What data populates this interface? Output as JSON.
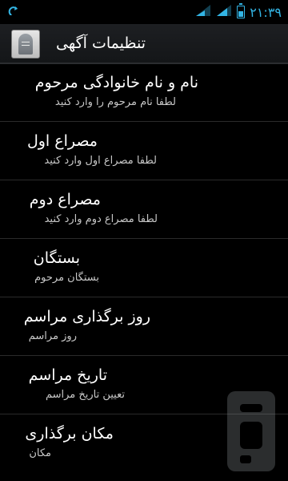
{
  "status_bar": {
    "time": "۲۱:۳۹",
    "icons": [
      "sync-icon",
      "signal-icon",
      "wifi-icon",
      "battery-icon"
    ],
    "accent_color": "#33b5e5"
  },
  "action_bar": {
    "title": "تنظیمات آگهی",
    "icon": "gravestone-app-icon"
  },
  "settings": [
    {
      "title": "نام و نام خانوادگی مرحوم",
      "summary": "لطفا نام مرحوم را وارد کنید"
    },
    {
      "title": "مصراع اول",
      "summary": "لطفا مصراع اول وارد کنید"
    },
    {
      "title": "مصراع دوم",
      "summary": "لطفا مصراع دوم وارد کنید"
    },
    {
      "title": "بستگان",
      "summary": "بستگان مرحوم"
    },
    {
      "title": "روز برگذاری مراسم",
      "summary": "روز مراسم"
    },
    {
      "title": "تاریخ مراسم",
      "summary": "تعیین تاریخ مراسم"
    },
    {
      "title": "مکان برگذاری",
      "summary": "مکان"
    }
  ],
  "colors": {
    "background": "#000000",
    "divider": "#2a2a2a",
    "title_text": "#ffffff",
    "summary_text": "#c8c8c8"
  }
}
